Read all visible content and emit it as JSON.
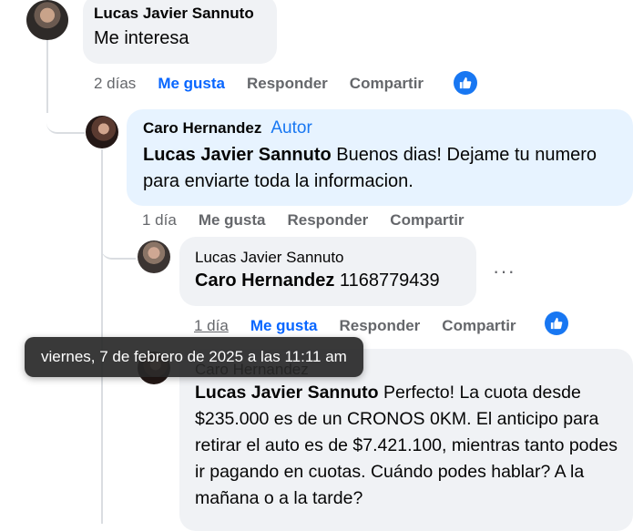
{
  "comments": [
    {
      "author": "Lucas Javier Sannuto",
      "text": "Me interesa",
      "time": "2 días",
      "like": "Me gusta",
      "reply": "Responder",
      "share": "Compartir"
    },
    {
      "author": "Caro Hernandez",
      "badge": "Autor",
      "mention": "Lucas Javier Sannuto",
      "text": " Buenos dias! Dejame tu numero para enviarte toda la informacion.",
      "time": "1 día",
      "like": "Me gusta",
      "reply": "Responder",
      "share": "Compartir"
    },
    {
      "author": "Lucas Javier Sannuto",
      "mention": "Caro Hernandez",
      "text": " 1168779439",
      "time": "1 día",
      "like": "Me gusta",
      "reply": "Responder",
      "share": "Compartir",
      "more": "···"
    },
    {
      "author": "Caro Hernandez",
      "mention": "Lucas Javier Sannuto",
      "text": " Perfecto! La cuota desde $235.000 es de un CRONOS 0KM. El anticipo para retirar el auto es de $7.421.100, mientras tanto podes ir pagando en cuotas. Cuándo podes hablar? A la mañana o a la tarde?"
    }
  ],
  "tooltip": "viernes, 7 de febrero de 2025 a las 11:11 am",
  "colors": {
    "accent": "#1877f2",
    "bubble": "#f0f2f5",
    "author_bubble": "#e7f3ff"
  }
}
